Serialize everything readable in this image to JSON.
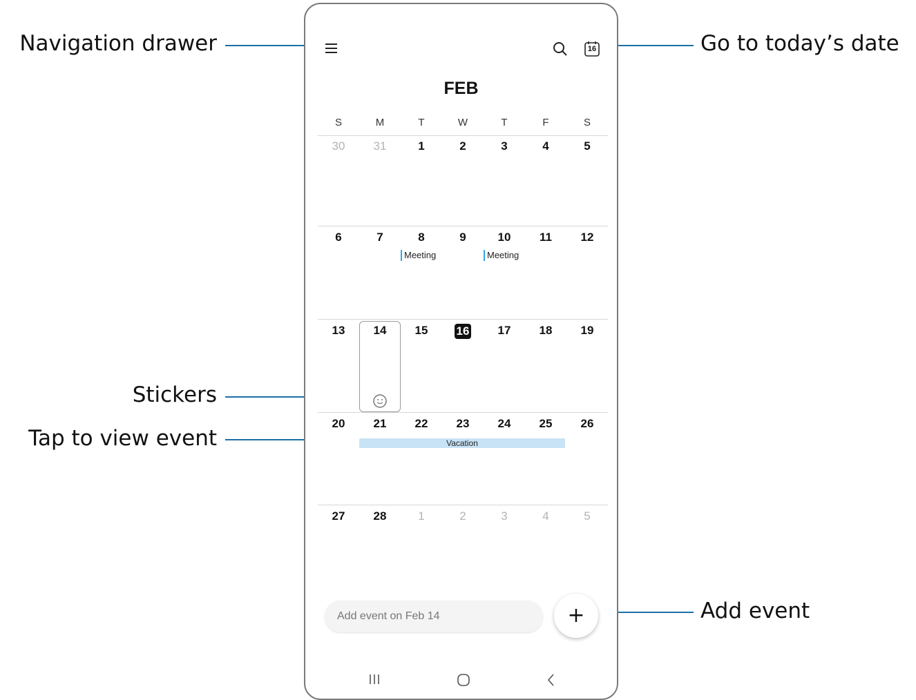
{
  "callouts": {
    "navigation_drawer": "Navigation drawer",
    "go_to_today": "Go to today’s date",
    "stickers": "Stickers",
    "tap_to_view_event": "Tap to view event",
    "add_event": "Add event"
  },
  "app": {
    "month": "FEB",
    "today_icon_number": "16",
    "icons": {
      "menu": "hamburger-icon",
      "search": "search-icon",
      "today": "calendar-today-icon",
      "sticker": "smiley-sticker-icon",
      "add": "plus-icon"
    },
    "weekdays": [
      "S",
      "M",
      "T",
      "W",
      "T",
      "F",
      "S"
    ],
    "weeks": [
      [
        "30",
        "31",
        "1",
        "2",
        "3",
        "4",
        "5"
      ],
      [
        "6",
        "7",
        "8",
        "9",
        "10",
        "11",
        "12"
      ],
      [
        "13",
        "14",
        "15",
        "16",
        "17",
        "18",
        "19"
      ],
      [
        "20",
        "21",
        "22",
        "23",
        "24",
        "25",
        "26"
      ],
      [
        "27",
        "28",
        "1",
        "2",
        "3",
        "4",
        "5"
      ]
    ],
    "events": {
      "meeting_1": "Meeting",
      "meeting_2": "Meeting",
      "vacation": "Vacation"
    },
    "add_placeholder": "Add event on Feb 14",
    "add_button": "+",
    "colors": {
      "accent": "#1a6fa8",
      "event_bar": "#2ea8e0",
      "vacation_fill": "#c7e3f5",
      "today_bg": "#111111"
    }
  }
}
